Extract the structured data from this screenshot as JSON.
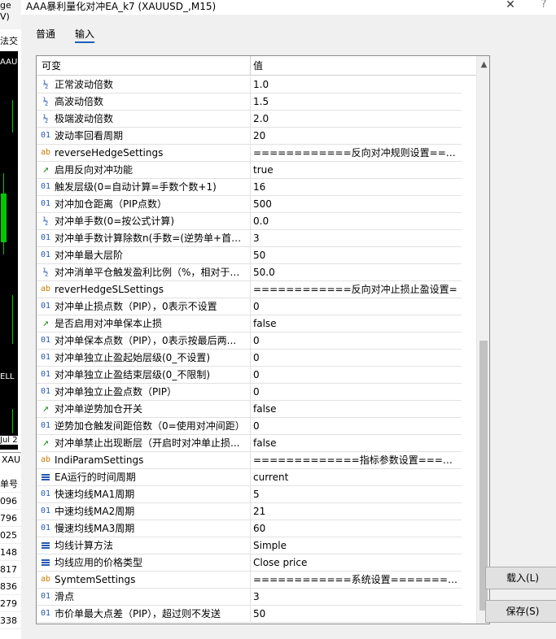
{
  "background_terminal": {
    "menu_fragments": [
      "ge",
      "V)",
      "法交"
    ],
    "chart_labels": [
      "AAU",
      "ELL",
      "Jul 2"
    ],
    "symbol": "XAU",
    "column_header": "单号",
    "order_ids": [
      "096",
      "796",
      "025",
      "148",
      "817",
      "836",
      "279",
      "338"
    ]
  },
  "window": {
    "title": "AAA暴利量化对冲EA_k7 (XAUUSD_,M15)",
    "close_glyph": "✕",
    "help_glyph": "?"
  },
  "tabs": [
    {
      "label": "普通",
      "active": false
    },
    {
      "label": "输入",
      "active": true
    }
  ],
  "grid": {
    "header_variable": "可变",
    "header_value": "值",
    "rows": [
      {
        "icon": "fraction-icon",
        "glyph": "½",
        "name": "正常波动倍数",
        "value": "1.0"
      },
      {
        "icon": "fraction-icon",
        "glyph": "½",
        "name": "高波动倍数",
        "value": "1.5"
      },
      {
        "icon": "fraction-icon",
        "glyph": "½",
        "name": "极端波动倍数",
        "value": "2.0"
      },
      {
        "icon": "integer-icon",
        "glyph": "01",
        "name": "波动率回看周期",
        "value": "20"
      },
      {
        "icon": "string-icon",
        "glyph": "ab",
        "name": "reverseHedgeSettings",
        "value": "============反向对冲规则设置===="
      },
      {
        "icon": "bool-icon",
        "glyph": "↗",
        "name": "启用反向对冲功能",
        "value": "true"
      },
      {
        "icon": "integer-icon",
        "glyph": "01",
        "name": "触发层级(0=自动计算=手数个数+1)",
        "value": "16"
      },
      {
        "icon": "integer-icon",
        "glyph": "01",
        "name": "对冲加仓距离（PIP点数）",
        "value": "500"
      },
      {
        "icon": "fraction-icon",
        "glyph": "½",
        "name": "对冲单手数(0=按公式计算)",
        "value": "0.0"
      },
      {
        "icon": "integer-icon",
        "glyph": "01",
        "name": "对冲单手数计算除数n(手数=(逆势单+首单...",
        "value": "3"
      },
      {
        "icon": "integer-icon",
        "glyph": "01",
        "name": "对冲单最大层阶",
        "value": "50"
      },
      {
        "icon": "fraction-icon",
        "glyph": "½",
        "name": "对冲消单平仓触发盈利比例（%，相对于目...",
        "value": "50.0"
      },
      {
        "icon": "string-icon",
        "glyph": "ab",
        "name": "reverHedgeSLSettings",
        "value": "============反向对冲止损止盈设置="
      },
      {
        "icon": "integer-icon",
        "glyph": "01",
        "name": "对冲单止损点数（PIP），0表示不设置",
        "value": "0"
      },
      {
        "icon": "bool-icon",
        "glyph": "↗",
        "name": "是否启用对冲单保本止损",
        "value": "false"
      },
      {
        "icon": "integer-icon",
        "glyph": "01",
        "name": "对冲单保本点数（PIP），0表示按最后两...",
        "value": "0"
      },
      {
        "icon": "integer-icon",
        "glyph": "01",
        "name": "对冲单独立止盈起始层级(0_不设置)",
        "value": "0"
      },
      {
        "icon": "integer-icon",
        "glyph": "01",
        "name": "对冲单独立止盈结束层级(0_不限制)",
        "value": "0"
      },
      {
        "icon": "integer-icon",
        "glyph": "01",
        "name": "对冲单独立止盈点数（PIP）",
        "value": "0"
      },
      {
        "icon": "bool-icon",
        "glyph": "↗",
        "name": "对冲单逆势加仓开关",
        "value": "false"
      },
      {
        "icon": "integer-icon",
        "glyph": "01",
        "name": "逆势加仓触发间距倍数（0=使用对冲间距）",
        "value": "0"
      },
      {
        "icon": "bool-icon",
        "glyph": "↗",
        "name": "对冲单禁止出现断层（开启时对冲单止损...",
        "value": "false"
      },
      {
        "icon": "string-icon",
        "glyph": "ab",
        "name": "IndiParamSettings",
        "value": "=============指标参数设置======="
      },
      {
        "icon": "enum-icon",
        "glyph": "",
        "name": "EA运行的时间周期",
        "value": "current"
      },
      {
        "icon": "integer-icon",
        "glyph": "01",
        "name": "快速均线MA1周期",
        "value": "5"
      },
      {
        "icon": "integer-icon",
        "glyph": "01",
        "name": "中速均线MA2周期",
        "value": "21"
      },
      {
        "icon": "integer-icon",
        "glyph": "01",
        "name": "慢速均线MA3周期",
        "value": "60"
      },
      {
        "icon": "enum-icon",
        "glyph": "",
        "name": "均线计算方法",
        "value": "Simple"
      },
      {
        "icon": "enum-icon",
        "glyph": "",
        "name": "均线应用的价格类型",
        "value": "Close price"
      },
      {
        "icon": "string-icon",
        "glyph": "ab",
        "name": "SymtemSettings",
        "value": "============系统设置=========="
      },
      {
        "icon": "integer-icon",
        "glyph": "01",
        "name": "滑点",
        "value": "3"
      },
      {
        "icon": "integer-icon",
        "glyph": "01",
        "name": "市价单最大点差（PIP），超过则不发送",
        "value": "50"
      }
    ]
  },
  "buttons": {
    "load": "载入(L)",
    "save": "保存(S)"
  },
  "scroll": {
    "up_glyph": "▲"
  },
  "colors": {
    "accent": "#1f5fbf",
    "icon_blue": "#2457b5",
    "icon_orange": "#c77a00",
    "icon_green": "#1a8f1a",
    "chart_bg": "#000000",
    "candle": "#00c800"
  }
}
